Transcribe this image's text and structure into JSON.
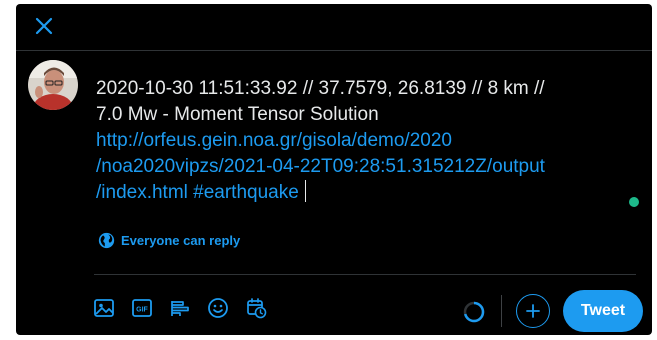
{
  "compose": {
    "text_line1": "2020-10-30 11:51:33.92 // 37.7579, 26.8139 // 8 km //",
    "text_line2": "7.0 Mw - Moment Tensor Solution",
    "link_line1": "http://orfeus.gein.noa.gr/gisola/demo/2020",
    "link_line2": "/noa2020vipzs/2021-04-22T09:28:51.315212Z/output",
    "link_line3": "/index.html #earthquake"
  },
  "reply_setting": {
    "label": "Everyone can reply",
    "icon": "globe-icon"
  },
  "toolbar": {
    "icons": [
      "image-icon",
      "gif-icon",
      "poll-icon",
      "emoji-icon",
      "schedule-icon"
    ],
    "gif_label": "GIF"
  },
  "actions": {
    "tweet_label": "Tweet",
    "add_icon": "plus-icon",
    "close_icon": "close-icon"
  },
  "colors": {
    "accent": "#1d9bf0",
    "background": "#000000",
    "text": "#e7e9ea",
    "status_dot": "#1db98a"
  }
}
